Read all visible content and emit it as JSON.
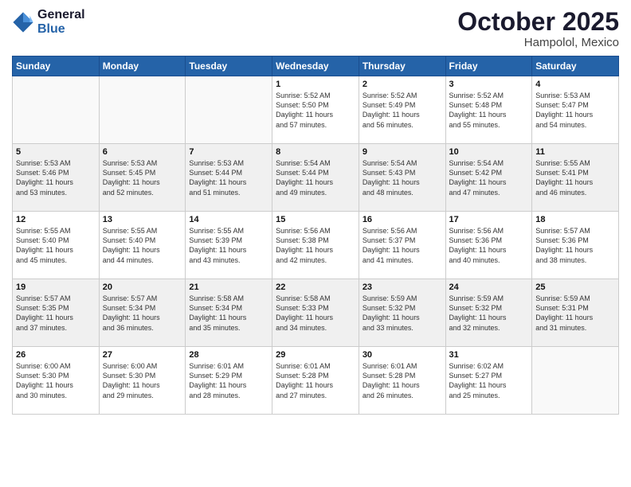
{
  "logo": {
    "line1": "General",
    "line2": "Blue"
  },
  "header": {
    "month": "October 2025",
    "location": "Hampolol, Mexico"
  },
  "weekdays": [
    "Sunday",
    "Monday",
    "Tuesday",
    "Wednesday",
    "Thursday",
    "Friday",
    "Saturday"
  ],
  "weeks": [
    {
      "shaded": false,
      "days": [
        {
          "num": "",
          "info": ""
        },
        {
          "num": "",
          "info": ""
        },
        {
          "num": "",
          "info": ""
        },
        {
          "num": "1",
          "info": "Sunrise: 5:52 AM\nSunset: 5:50 PM\nDaylight: 11 hours\nand 57 minutes."
        },
        {
          "num": "2",
          "info": "Sunrise: 5:52 AM\nSunset: 5:49 PM\nDaylight: 11 hours\nand 56 minutes."
        },
        {
          "num": "3",
          "info": "Sunrise: 5:52 AM\nSunset: 5:48 PM\nDaylight: 11 hours\nand 55 minutes."
        },
        {
          "num": "4",
          "info": "Sunrise: 5:53 AM\nSunset: 5:47 PM\nDaylight: 11 hours\nand 54 minutes."
        }
      ]
    },
    {
      "shaded": true,
      "days": [
        {
          "num": "5",
          "info": "Sunrise: 5:53 AM\nSunset: 5:46 PM\nDaylight: 11 hours\nand 53 minutes."
        },
        {
          "num": "6",
          "info": "Sunrise: 5:53 AM\nSunset: 5:45 PM\nDaylight: 11 hours\nand 52 minutes."
        },
        {
          "num": "7",
          "info": "Sunrise: 5:53 AM\nSunset: 5:44 PM\nDaylight: 11 hours\nand 51 minutes."
        },
        {
          "num": "8",
          "info": "Sunrise: 5:54 AM\nSunset: 5:44 PM\nDaylight: 11 hours\nand 49 minutes."
        },
        {
          "num": "9",
          "info": "Sunrise: 5:54 AM\nSunset: 5:43 PM\nDaylight: 11 hours\nand 48 minutes."
        },
        {
          "num": "10",
          "info": "Sunrise: 5:54 AM\nSunset: 5:42 PM\nDaylight: 11 hours\nand 47 minutes."
        },
        {
          "num": "11",
          "info": "Sunrise: 5:55 AM\nSunset: 5:41 PM\nDaylight: 11 hours\nand 46 minutes."
        }
      ]
    },
    {
      "shaded": false,
      "days": [
        {
          "num": "12",
          "info": "Sunrise: 5:55 AM\nSunset: 5:40 PM\nDaylight: 11 hours\nand 45 minutes."
        },
        {
          "num": "13",
          "info": "Sunrise: 5:55 AM\nSunset: 5:40 PM\nDaylight: 11 hours\nand 44 minutes."
        },
        {
          "num": "14",
          "info": "Sunrise: 5:55 AM\nSunset: 5:39 PM\nDaylight: 11 hours\nand 43 minutes."
        },
        {
          "num": "15",
          "info": "Sunrise: 5:56 AM\nSunset: 5:38 PM\nDaylight: 11 hours\nand 42 minutes."
        },
        {
          "num": "16",
          "info": "Sunrise: 5:56 AM\nSunset: 5:37 PM\nDaylight: 11 hours\nand 41 minutes."
        },
        {
          "num": "17",
          "info": "Sunrise: 5:56 AM\nSunset: 5:36 PM\nDaylight: 11 hours\nand 40 minutes."
        },
        {
          "num": "18",
          "info": "Sunrise: 5:57 AM\nSunset: 5:36 PM\nDaylight: 11 hours\nand 38 minutes."
        }
      ]
    },
    {
      "shaded": true,
      "days": [
        {
          "num": "19",
          "info": "Sunrise: 5:57 AM\nSunset: 5:35 PM\nDaylight: 11 hours\nand 37 minutes."
        },
        {
          "num": "20",
          "info": "Sunrise: 5:57 AM\nSunset: 5:34 PM\nDaylight: 11 hours\nand 36 minutes."
        },
        {
          "num": "21",
          "info": "Sunrise: 5:58 AM\nSunset: 5:34 PM\nDaylight: 11 hours\nand 35 minutes."
        },
        {
          "num": "22",
          "info": "Sunrise: 5:58 AM\nSunset: 5:33 PM\nDaylight: 11 hours\nand 34 minutes."
        },
        {
          "num": "23",
          "info": "Sunrise: 5:59 AM\nSunset: 5:32 PM\nDaylight: 11 hours\nand 33 minutes."
        },
        {
          "num": "24",
          "info": "Sunrise: 5:59 AM\nSunset: 5:32 PM\nDaylight: 11 hours\nand 32 minutes."
        },
        {
          "num": "25",
          "info": "Sunrise: 5:59 AM\nSunset: 5:31 PM\nDaylight: 11 hours\nand 31 minutes."
        }
      ]
    },
    {
      "shaded": false,
      "days": [
        {
          "num": "26",
          "info": "Sunrise: 6:00 AM\nSunset: 5:30 PM\nDaylight: 11 hours\nand 30 minutes."
        },
        {
          "num": "27",
          "info": "Sunrise: 6:00 AM\nSunset: 5:30 PM\nDaylight: 11 hours\nand 29 minutes."
        },
        {
          "num": "28",
          "info": "Sunrise: 6:01 AM\nSunset: 5:29 PM\nDaylight: 11 hours\nand 28 minutes."
        },
        {
          "num": "29",
          "info": "Sunrise: 6:01 AM\nSunset: 5:28 PM\nDaylight: 11 hours\nand 27 minutes."
        },
        {
          "num": "30",
          "info": "Sunrise: 6:01 AM\nSunset: 5:28 PM\nDaylight: 11 hours\nand 26 minutes."
        },
        {
          "num": "31",
          "info": "Sunrise: 6:02 AM\nSunset: 5:27 PM\nDaylight: 11 hours\nand 25 minutes."
        },
        {
          "num": "",
          "info": ""
        }
      ]
    }
  ]
}
